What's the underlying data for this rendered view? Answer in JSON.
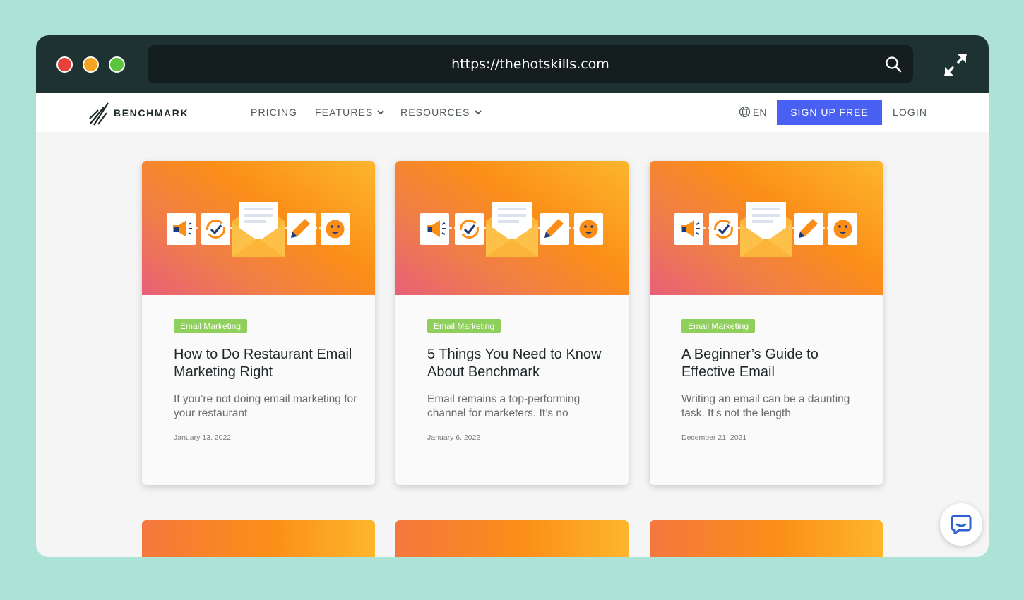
{
  "browser": {
    "url": "https://thehotskills.com"
  },
  "nav": {
    "logo_text": "BENCHMARK",
    "pricing": "PRICING",
    "features": "FEATURES",
    "resources": "RESOURCES",
    "language": "EN",
    "signup": "SIGN UP FREE",
    "login": "LOGIN"
  },
  "colors": {
    "accent_blue": "#4a60f2",
    "tag_green": "#8fcf5c",
    "titlebar": "#1e3232",
    "page_bg": "#ade3d7"
  },
  "cards": [
    {
      "tag": "Email Marketing",
      "title": "How to Do Restaurant Email Marketing Right",
      "excerpt": "If you’re not doing email marketing for your restaurant",
      "date": "January 13, 2022"
    },
    {
      "tag": "Email Marketing",
      "title": "5 Things You Need to Know About Benchmark",
      "excerpt": "Email remains a top-performing channel for marketers. It’s no",
      "date": "January 6, 2022"
    },
    {
      "tag": "Email Marketing",
      "title": "A Beginner’s Guide to Effective Email",
      "excerpt": "Writing an email can be a daunting task. It’s not the length",
      "date": "December 21, 2021"
    }
  ],
  "icons": [
    "search-icon",
    "expand-icon",
    "benchmark-logo-icon",
    "chevron-down-icon",
    "globe-icon",
    "megaphone-icon",
    "sync-check-icon",
    "envelope-icon",
    "pencil-icon",
    "smiley-icon",
    "chat-icon"
  ]
}
